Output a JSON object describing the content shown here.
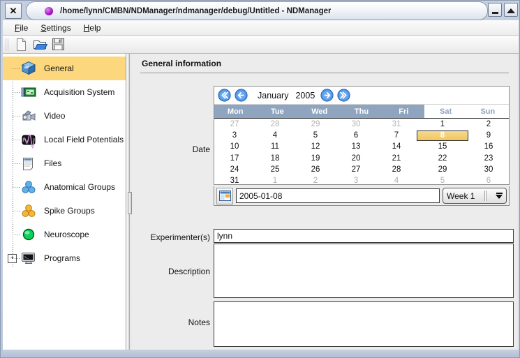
{
  "window": {
    "title": "/home/lynn/CMBN/NDManager/ndmanager/debug/Untitled - NDManager",
    "close_label": "✕",
    "minimize_name": "minimize-button",
    "maximize_name": "maximize-button"
  },
  "menubar": {
    "items": [
      {
        "mnemonic": "F",
        "rest": "ile"
      },
      {
        "mnemonic": "S",
        "rest": "ettings"
      },
      {
        "mnemonic": "H",
        "rest": "elp"
      }
    ]
  },
  "toolbar": {
    "buttons": [
      {
        "name": "new-file-button",
        "icon": "new-document-icon"
      },
      {
        "name": "open-file-button",
        "icon": "open-folder-icon"
      },
      {
        "name": "save-file-button",
        "icon": "floppy-disk-icon"
      }
    ]
  },
  "sidebar": {
    "items": [
      {
        "label": "General",
        "icon": "blue-cube-icon",
        "selected": true,
        "expander": null
      },
      {
        "label": "Acquisition System",
        "icon": "circuit-board-icon",
        "selected": false,
        "expander": null
      },
      {
        "label": "Video",
        "icon": "camcorder-icon",
        "selected": false,
        "expander": null
      },
      {
        "label": "Local Field Potentials",
        "icon": "waveform-icon",
        "selected": false,
        "expander": null
      },
      {
        "label": "Files",
        "icon": "spreadsheet-page-icon",
        "selected": false,
        "expander": null
      },
      {
        "label": "Anatomical Groups",
        "icon": "blue-spheres-icon",
        "selected": false,
        "expander": null
      },
      {
        "label": "Spike Groups",
        "icon": "orange-spheres-icon",
        "selected": false,
        "expander": null
      },
      {
        "label": "Neuroscope",
        "icon": "green-sphere-icon",
        "selected": false,
        "expander": null
      },
      {
        "label": "Programs",
        "icon": "terminal-monitor-icon",
        "selected": false,
        "expander": "+"
      }
    ]
  },
  "panel": {
    "title": "General information",
    "date_label": "Date",
    "experimenters_label": "Experimenter(s)",
    "experimenters_value": "lynn",
    "description_label": "Description",
    "description_value": "",
    "notes_label": "Notes",
    "notes_value": ""
  },
  "calendar": {
    "month": "January",
    "year": "2005",
    "nav": [
      {
        "name": "previous-year-button",
        "icon": "double-left-arrow-icon"
      },
      {
        "name": "previous-month-button",
        "icon": "left-arrow-icon"
      },
      {
        "name": "next-month-button",
        "icon": "right-arrow-icon"
      },
      {
        "name": "next-year-button",
        "icon": "double-right-arrow-icon"
      }
    ],
    "weekdays": [
      "Mon",
      "Tue",
      "Wed",
      "Thu",
      "Fri",
      "Sat",
      "Sun"
    ],
    "weekend_index": [
      5,
      6
    ],
    "days": [
      {
        "n": "27",
        "other": true
      },
      {
        "n": "28",
        "other": true
      },
      {
        "n": "29",
        "other": true
      },
      {
        "n": "30",
        "other": true
      },
      {
        "n": "31",
        "other": true
      },
      {
        "n": "1",
        "other": false
      },
      {
        "n": "2",
        "other": false
      },
      {
        "n": "3",
        "other": false
      },
      {
        "n": "4",
        "other": false
      },
      {
        "n": "5",
        "other": false
      },
      {
        "n": "6",
        "other": false
      },
      {
        "n": "7",
        "other": false
      },
      {
        "n": "8",
        "other": false,
        "selected": true
      },
      {
        "n": "9",
        "other": false
      },
      {
        "n": "10",
        "other": false
      },
      {
        "n": "11",
        "other": false
      },
      {
        "n": "12",
        "other": false
      },
      {
        "n": "13",
        "other": false
      },
      {
        "n": "14",
        "other": false
      },
      {
        "n": "15",
        "other": false
      },
      {
        "n": "16",
        "other": false
      },
      {
        "n": "17",
        "other": false
      },
      {
        "n": "18",
        "other": false
      },
      {
        "n": "19",
        "other": false
      },
      {
        "n": "20",
        "other": false
      },
      {
        "n": "21",
        "other": false
      },
      {
        "n": "22",
        "other": false
      },
      {
        "n": "23",
        "other": false
      },
      {
        "n": "24",
        "other": false
      },
      {
        "n": "25",
        "other": false
      },
      {
        "n": "26",
        "other": false
      },
      {
        "n": "27",
        "other": false
      },
      {
        "n": "28",
        "other": false
      },
      {
        "n": "29",
        "other": false
      },
      {
        "n": "30",
        "other": false
      },
      {
        "n": "31",
        "other": false
      },
      {
        "n": "1",
        "other": true
      },
      {
        "n": "2",
        "other": true
      },
      {
        "n": "3",
        "other": true
      },
      {
        "n": "4",
        "other": true
      },
      {
        "n": "5",
        "other": true
      },
      {
        "n": "6",
        "other": true
      }
    ],
    "date_value": "2005-01-08",
    "week_value": "Week 1",
    "picker_icon": "calendar-table-icon"
  },
  "colors": {
    "selection": "#fcd77e",
    "header_band": "#8ea4bf",
    "day_selected_top": "#f7dc93",
    "day_selected_bottom": "#efc45c",
    "panel_bg": "#ececec",
    "accent_blue": "#2a6fd4"
  }
}
